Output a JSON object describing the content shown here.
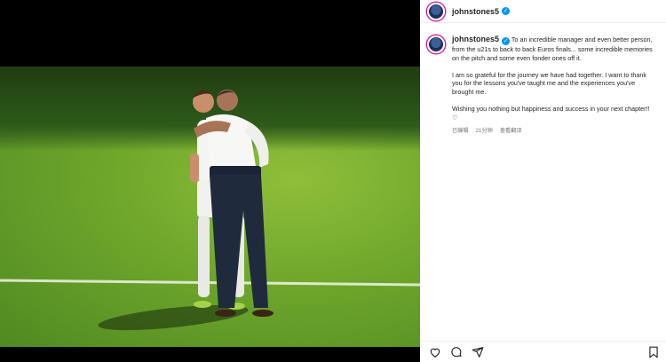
{
  "header": {
    "username": "johnstones5",
    "verified": true
  },
  "post": {
    "username": "johnstones5",
    "caption_p1": "To an incredible manager and even better person, from the u21s to back to back Euros finals... some incredible memories on the pitch and some even fonder ones off it.",
    "caption_p2": "I am so grateful for the journey we have had together. I want to thank you for the lessons you've taught me and the experiences you've brought me.",
    "caption_p3": "Wishing you nothing but happiness and success in your next chapter!! ♡",
    "edited": "已编辑",
    "time": "21分钟",
    "translate": "查看翻译"
  },
  "icons": [
    "heart-icon",
    "comment-icon",
    "share-icon",
    "bookmark-icon",
    "verified-icon"
  ]
}
